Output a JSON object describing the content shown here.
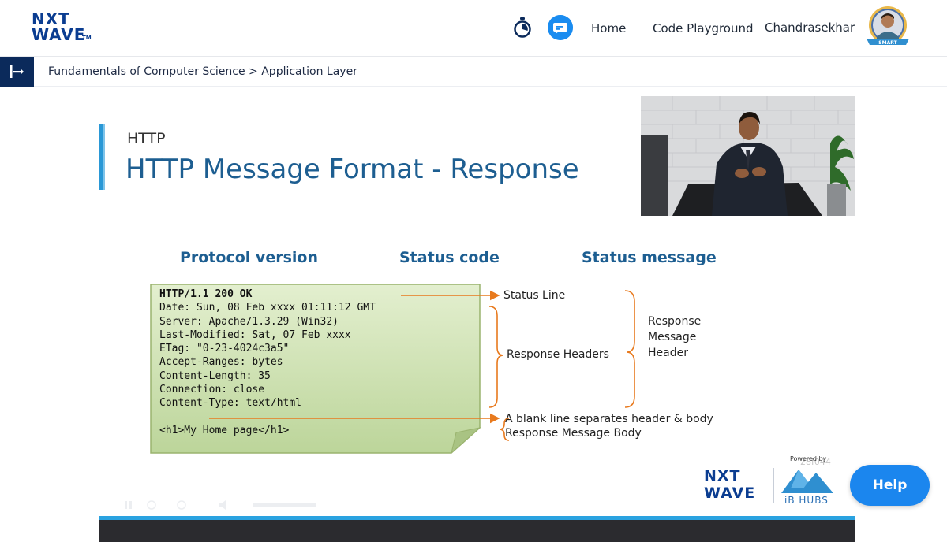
{
  "header": {
    "logo": {
      "line1": "NXT",
      "line2": "WAVE",
      "tm": "TM"
    },
    "nav": {
      "home": "Home",
      "code_playground": "Code Playground",
      "user_name": "Chandrasekhar"
    },
    "avatar_badge": "SMART",
    "icons": {
      "timer": "stopwatch-icon",
      "chat": "chat-bubble-icon"
    }
  },
  "breadcrumb": {
    "course": "Fundamentals of Computer Science",
    "separator": " > ",
    "topic": "Application Layer"
  },
  "slide": {
    "subtitle": "HTTP",
    "title": "HTTP Message Format - Response",
    "columns": [
      "Protocol version",
      "Status code",
      "Status message"
    ],
    "code_lines": [
      "HTTP/1.1 200 OK",
      "Date: Sun, 08 Feb xxxx 01:11:12 GMT",
      "Server: Apache/1.3.29 (Win32)",
      "Last-Modified: Sat, 07 Feb xxxx",
      "ETag: \"0-23-4024c3a5\"",
      "Accept-Ranges: bytes",
      "Content-Length: 35",
      "Connection: close",
      "Content-Type: text/html",
      "",
      "<h1>My Home page</h1>"
    ],
    "labels": {
      "status_line": "Status Line",
      "response_headers": "Response Headers",
      "response_message_header": [
        "Response",
        "Message",
        "Header"
      ],
      "blank_line": "A blank line separates header & body",
      "message_body": "Response Message Body"
    },
    "branding": {
      "nxt": "NXT",
      "wave": "WAVE",
      "powered_by": "Powered by",
      "ibhubs": "iB HUBS",
      "overlay_number": "28f044"
    }
  },
  "help_button": {
    "label": "Help"
  },
  "colors": {
    "title_blue": "#1d5e91",
    "brand_navy": "#0b3d91",
    "help_blue": "#1b86ee",
    "arrow_orange": "#e87a1e",
    "note_green": "#c9deab",
    "progress_blue": "#2aa2e0"
  }
}
